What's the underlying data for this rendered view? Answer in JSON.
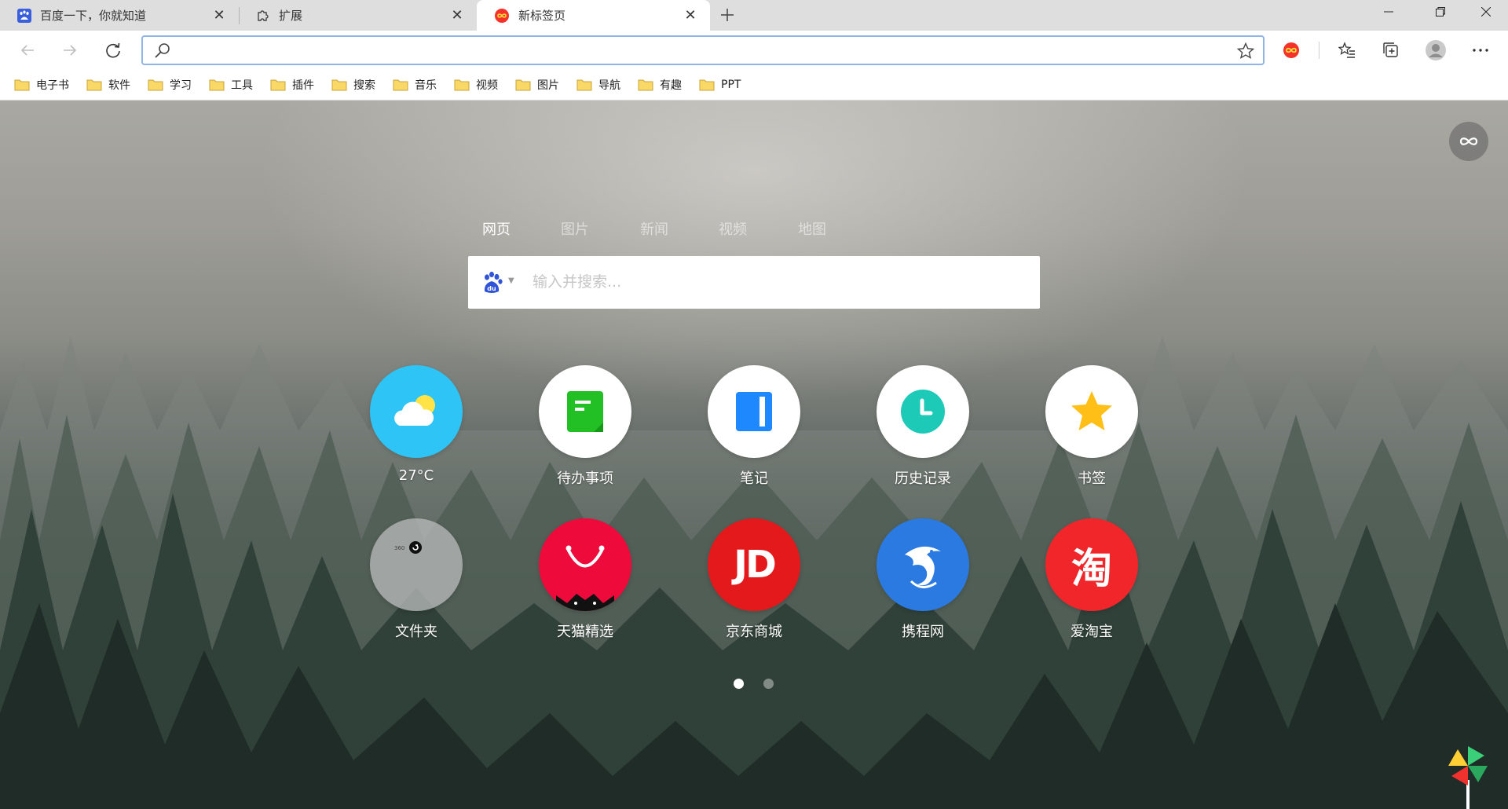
{
  "tabs": [
    {
      "title": "百度一下，你就知道",
      "icon": "baidu-paw-icon",
      "active": false
    },
    {
      "title": "扩展",
      "icon": "puzzle-icon",
      "active": false
    },
    {
      "title": "新标签页",
      "icon": "infinity-icon",
      "active": true
    }
  ],
  "window_controls": {
    "minimize": "—",
    "maximize": "▢",
    "close": "✕"
  },
  "address_bar": {
    "value": "",
    "placeholder": ""
  },
  "bookmarks": [
    "电子书",
    "软件",
    "学习",
    "工具",
    "插件",
    "搜索",
    "音乐",
    "视频",
    "图片",
    "导航",
    "有趣",
    "PPT"
  ],
  "search": {
    "tabs": [
      "网页",
      "图片",
      "新闻",
      "视频",
      "地图"
    ],
    "active_tab": "网页",
    "placeholder": "输入并搜索...",
    "engine_icon": "baidu-du-icon"
  },
  "apps": [
    {
      "label": "27°C",
      "icon": "weather-icon"
    },
    {
      "label": "待办事项",
      "icon": "todo-icon"
    },
    {
      "label": "笔记",
      "icon": "notes-icon"
    },
    {
      "label": "历史记录",
      "icon": "history-icon"
    },
    {
      "label": "书签",
      "icon": "star-icon"
    },
    {
      "label": "文件夹",
      "icon": "folder-icon"
    },
    {
      "label": "天猫精选",
      "icon": "tmall-icon"
    },
    {
      "label": "京东商城",
      "icon": "jd-icon",
      "icon_text": "JD"
    },
    {
      "label": "携程网",
      "icon": "ctrip-icon"
    },
    {
      "label": "爱淘宝",
      "icon": "taobao-icon",
      "icon_text": "淘"
    }
  ],
  "pagination": {
    "current": 1,
    "total": 2
  },
  "colors": {
    "weather": "#2ec4f5",
    "todo": "#22c024",
    "notes": "#1e88ff",
    "history": "#1dcab8",
    "star": "#ffbf16",
    "tmall": "#ee0a3b",
    "jd": "#e4191c",
    "ctrip": "#2a7ae2",
    "taobao": "#f0262a",
    "accent_red": "#ff3b30"
  }
}
